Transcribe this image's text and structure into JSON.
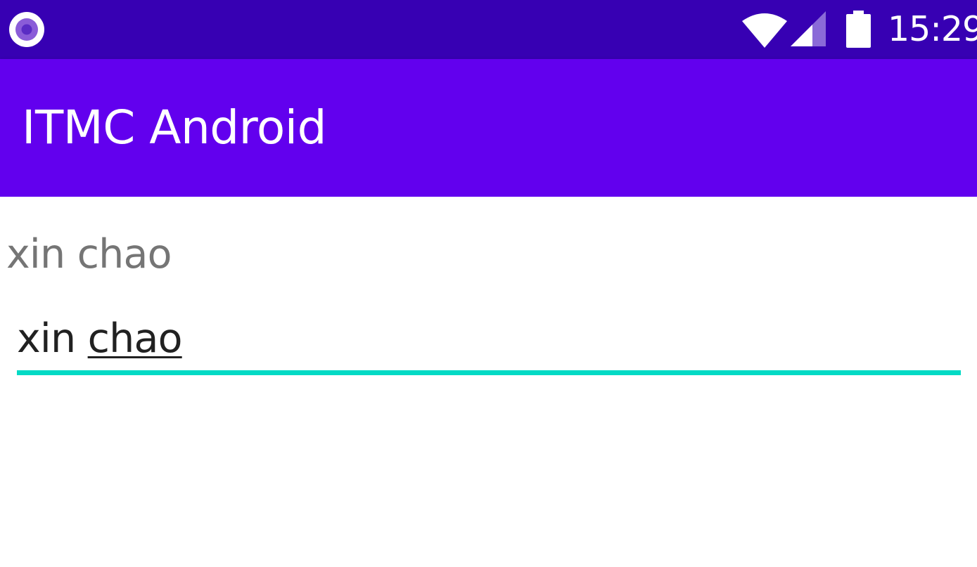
{
  "status_bar": {
    "notification_icon": "notification-dot-icon",
    "wifi_icon": "wifi-icon",
    "signal_icon": "cell-signal-icon",
    "battery_icon": "battery-icon",
    "time": "15:29",
    "color": "#3700b3"
  },
  "app_bar": {
    "title": "ITMC Android",
    "color": "#6200ee"
  },
  "main": {
    "text_view": "xin chao",
    "edit_text": {
      "committed": "xin ",
      "composing": "chao"
    },
    "accent_color": "#03dac5"
  }
}
